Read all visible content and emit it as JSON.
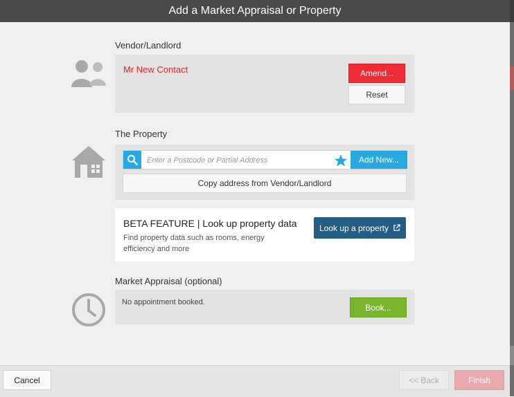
{
  "dialog": {
    "title": "Add a Market Appraisal or Property"
  },
  "vendor": {
    "section_label": "Vendor/Landlord",
    "contact_name": "Mr New Contact",
    "amend_label": "Amend...",
    "reset_label": "Reset"
  },
  "property": {
    "section_label": "The Property",
    "search_placeholder": "Enter a Postcode or Partial Address",
    "search_value": "",
    "add_new_label": "Add New...",
    "copy_address_label": "Copy address from Vendor/Landlord"
  },
  "beta": {
    "title": "BETA FEATURE | Look up property data",
    "description": "Find property data such as rooms, energy efficiency and more",
    "lookup_label": "Look up a property"
  },
  "appraisal": {
    "section_label": "Market Appraisal (optional)",
    "status_text": "No appointment booked.",
    "book_label": "Book..."
  },
  "footer": {
    "cancel_label": "Cancel",
    "back_label": "<< Back",
    "finish_label": "Finish"
  },
  "colors": {
    "title_bar": "#4a4a4a",
    "amend": "#ef2b36",
    "accent_blue": "#29a9e1",
    "lookup_button": "#245e82",
    "book": "#7ab52e",
    "finish_disabled": "#eaaaad"
  }
}
